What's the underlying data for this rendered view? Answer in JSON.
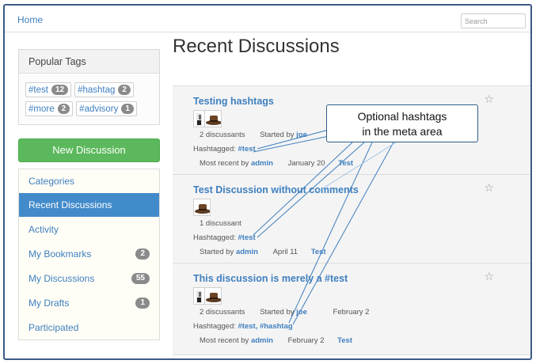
{
  "header": {
    "home_label": "Home",
    "search_placeholder": "Search"
  },
  "sidebar": {
    "popular_tags_title": "Popular Tags",
    "tags": [
      {
        "label": "#test",
        "count": "12"
      },
      {
        "label": "#hashtag",
        "count": "2"
      },
      {
        "label": "#more",
        "count": "2"
      },
      {
        "label": "#advisory",
        "count": "1"
      }
    ],
    "new_discussion_label": "New Discussion",
    "nav": [
      {
        "label": "Categories",
        "badge": ""
      },
      {
        "label": "Recent Discussions",
        "badge": "",
        "active": true
      },
      {
        "label": "Activity",
        "badge": ""
      },
      {
        "label": "My Bookmarks",
        "badge": "2"
      },
      {
        "label": "My Discussions",
        "badge": "55"
      },
      {
        "label": "My Drafts",
        "badge": "1"
      },
      {
        "label": "Participated",
        "badge": ""
      }
    ]
  },
  "main": {
    "page_title": "Recent Discussions",
    "discussions": [
      {
        "title": "Testing hashtags",
        "discussants": "2 discussants",
        "started_by_label": "Started by",
        "started_by": "joe",
        "hashtagged_label": "Hashtagged:",
        "hashtags": "#test",
        "recent_label": "Most recent by",
        "recent_user": "admin",
        "date": "January 20",
        "category": "Test"
      },
      {
        "title": "Test Discussion without comments",
        "discussants": "1 discussant",
        "hashtagged_label": "Hashtagged:",
        "hashtags": "#test",
        "started_by_label": "Started by",
        "started_by": "admin",
        "date": "April 11",
        "category": "Test"
      },
      {
        "title": "This discussion is merely a #test",
        "discussants": "2 discussants",
        "started_by_label": "Started by",
        "started_by": "joe",
        "date_started": "February 2",
        "hashtagged_label": "Hashtagged:",
        "hashtags": "#test, #hashtag",
        "recent_label": "Most recent by",
        "recent_user": "admin",
        "date": "February 2",
        "category": "Test"
      }
    ]
  },
  "callout": {
    "line1": "Optional hashtags",
    "line2": "in the meta area"
  },
  "colors": {
    "accent": "#428bca",
    "link": "#3f7fbf",
    "button": "#5cb85c",
    "frame": "#3b5a85"
  }
}
